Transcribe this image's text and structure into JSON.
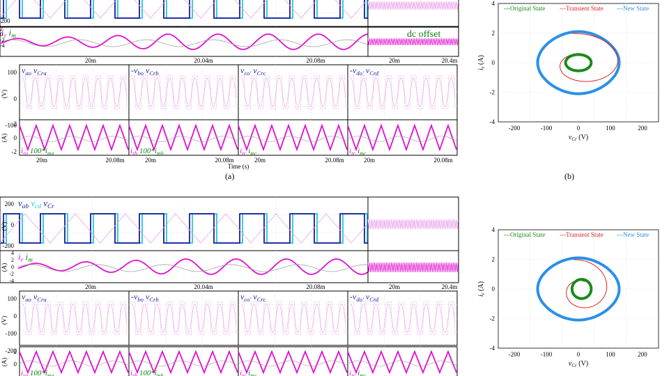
{
  "captions": {
    "a": "(a)",
    "b": "(b)"
  },
  "colors": {
    "navy": "#1a1aa0",
    "cyan": "#22c8d8",
    "magenta": "#e010d0",
    "green": "#108010",
    "pink": "#e8a0e8",
    "gray": "#9a9a9a",
    "orig": "#1a8a1a",
    "trans": "#e02020",
    "newst": "#2a90e8"
  },
  "chart_data": [
    {
      "id": "top-waveforms",
      "type": "line",
      "panels": [
        {
          "id": "voltage",
          "ylabel": "(V)",
          "ylim": [
            -200,
            200
          ],
          "yticks": [
            "-200"
          ],
          "labels": [],
          "series": []
        },
        {
          "id": "current",
          "ylabel": "(A)",
          "yticks": [
            "4",
            "2",
            "0",
            "-2",
            "-4"
          ],
          "ylim": [
            -4,
            4
          ],
          "labels": [
            "i",
            "r",
            " i",
            "m"
          ],
          "annotation": "dc offset"
        }
      ],
      "xticks": [
        "20m",
        "20.04m",
        "20.08m"
      ],
      "zoom_xticks": [
        "20m",
        "20.4m"
      ]
    },
    {
      "id": "top-subplots",
      "type": "line",
      "ylabels": [
        "(V)",
        "(A)"
      ],
      "v_yticks": [
        "100",
        "0",
        "-100"
      ],
      "i_yticks": [
        "2",
        "0",
        "-2"
      ],
      "xticks_left": [
        "20m",
        "20.08m"
      ],
      "xlabel": "Time (s)",
      "panels": [
        {
          "v_label": [
            "v",
            "ao",
            " v",
            "Cra"
          ],
          "i_label": [
            "i",
            "ra",
            " 100*i",
            "ma"
          ]
        },
        {
          "v_label": [
            "-v",
            "bo",
            " v",
            "Crb"
          ],
          "i_label": [
            "i",
            "rb",
            " 100*i",
            "mb"
          ]
        },
        {
          "v_label": [
            "v",
            "co'",
            " v",
            "Crc"
          ],
          "i_label": [
            "i",
            "rc",
            " i",
            "mc"
          ]
        },
        {
          "v_label": [
            "-v",
            "do'",
            " v",
            "Crd"
          ],
          "i_label": [
            "i",
            "rc",
            " i",
            "mc"
          ]
        }
      ]
    },
    {
      "id": "top-state-plane",
      "type": "scatter",
      "legend": [
        "---Original State",
        "---Transient State",
        "---New State"
      ],
      "xlabel": "v",
      "xlabel_sub": "Cr",
      "xlabel_unit": " (V)",
      "ylabel": "i",
      "ylabel_sub": "r",
      "ylabel_unit": " (A)",
      "xlim": [
        -250,
        250
      ],
      "ylim": [
        -4,
        4
      ],
      "xticks": [
        -200,
        -100,
        0,
        100,
        200
      ],
      "yticks": [
        -4,
        -2,
        0,
        2,
        4
      ],
      "original": {
        "cx": 0,
        "cy": 0,
        "rx": 40,
        "ry": 0.55
      },
      "new": {
        "cx": 0,
        "cy": 0,
        "rx": 120,
        "ry": 2.1
      },
      "transient_peak": {
        "x": 155,
        "y": 0
      }
    },
    {
      "id": "bottom-waveforms",
      "type": "line",
      "panels": [
        {
          "id": "voltage",
          "ylabel": "(V)",
          "ylim": [
            -200,
            200
          ],
          "yticks": [
            "200",
            "0",
            "-200"
          ],
          "labels": [
            "v",
            "ab",
            " v",
            "cd",
            " v",
            "Cr"
          ]
        },
        {
          "id": "current",
          "ylabel": "(A)",
          "yticks": [
            "4",
            "2",
            "0",
            "-2",
            "-4"
          ],
          "ylim": [
            -4,
            4
          ],
          "labels": [
            "i",
            "r",
            " i",
            "m"
          ]
        }
      ],
      "xticks": [
        "20m",
        "20.04m",
        "20.08m"
      ],
      "zoom_xticks": [
        "20m",
        "20.4m"
      ]
    },
    {
      "id": "bottom-subplots",
      "type": "line",
      "ylabels": [
        "(V)",
        "(A)"
      ],
      "v_yticks": [
        "100",
        "0",
        "-100",
        "-200"
      ],
      "i_yticks": [
        "2",
        "0"
      ],
      "panels": [
        {
          "v_label": [
            "v",
            "ao",
            " v",
            "Cra"
          ],
          "i_label": [
            "i",
            "ra",
            " 100*i",
            "ma"
          ]
        },
        {
          "v_label": [
            "-v",
            "bo",
            " v",
            "Crb"
          ],
          "i_label": [
            "i",
            "rb",
            " 100*i",
            "mb"
          ]
        },
        {
          "v_label": [
            "v",
            "co'",
            " v",
            "Crc"
          ],
          "i_label": [
            "i",
            "rc",
            " i",
            "mc"
          ]
        },
        {
          "v_label": [
            "-v",
            "do'",
            " v",
            "Crd"
          ],
          "i_label": [
            "i",
            "rc",
            " i",
            "mc"
          ]
        }
      ]
    },
    {
      "id": "bottom-state-plane",
      "type": "scatter",
      "legend": [
        "---Original State",
        "---Transient State",
        "---New State"
      ],
      "xlabel": "v",
      "xlabel_sub": "Cr",
      "xlabel_unit": " (V)",
      "ylabel": "i",
      "ylabel_sub": "r",
      "ylabel_unit": " (A)",
      "xlim": [
        -250,
        250
      ],
      "ylim": [
        -4,
        4
      ],
      "xticks": [
        -200,
        -100,
        0,
        100,
        200
      ],
      "yticks": [
        -4,
        -2,
        0,
        2,
        4
      ],
      "original": {
        "cx": 10,
        "cy": 0,
        "rx": 30,
        "ry": 0.65
      },
      "new": {
        "cx": 0,
        "cy": 0,
        "rx": 120,
        "ry": 2.1
      },
      "transient_peak": {
        "x": 110,
        "y": 0
      }
    }
  ]
}
